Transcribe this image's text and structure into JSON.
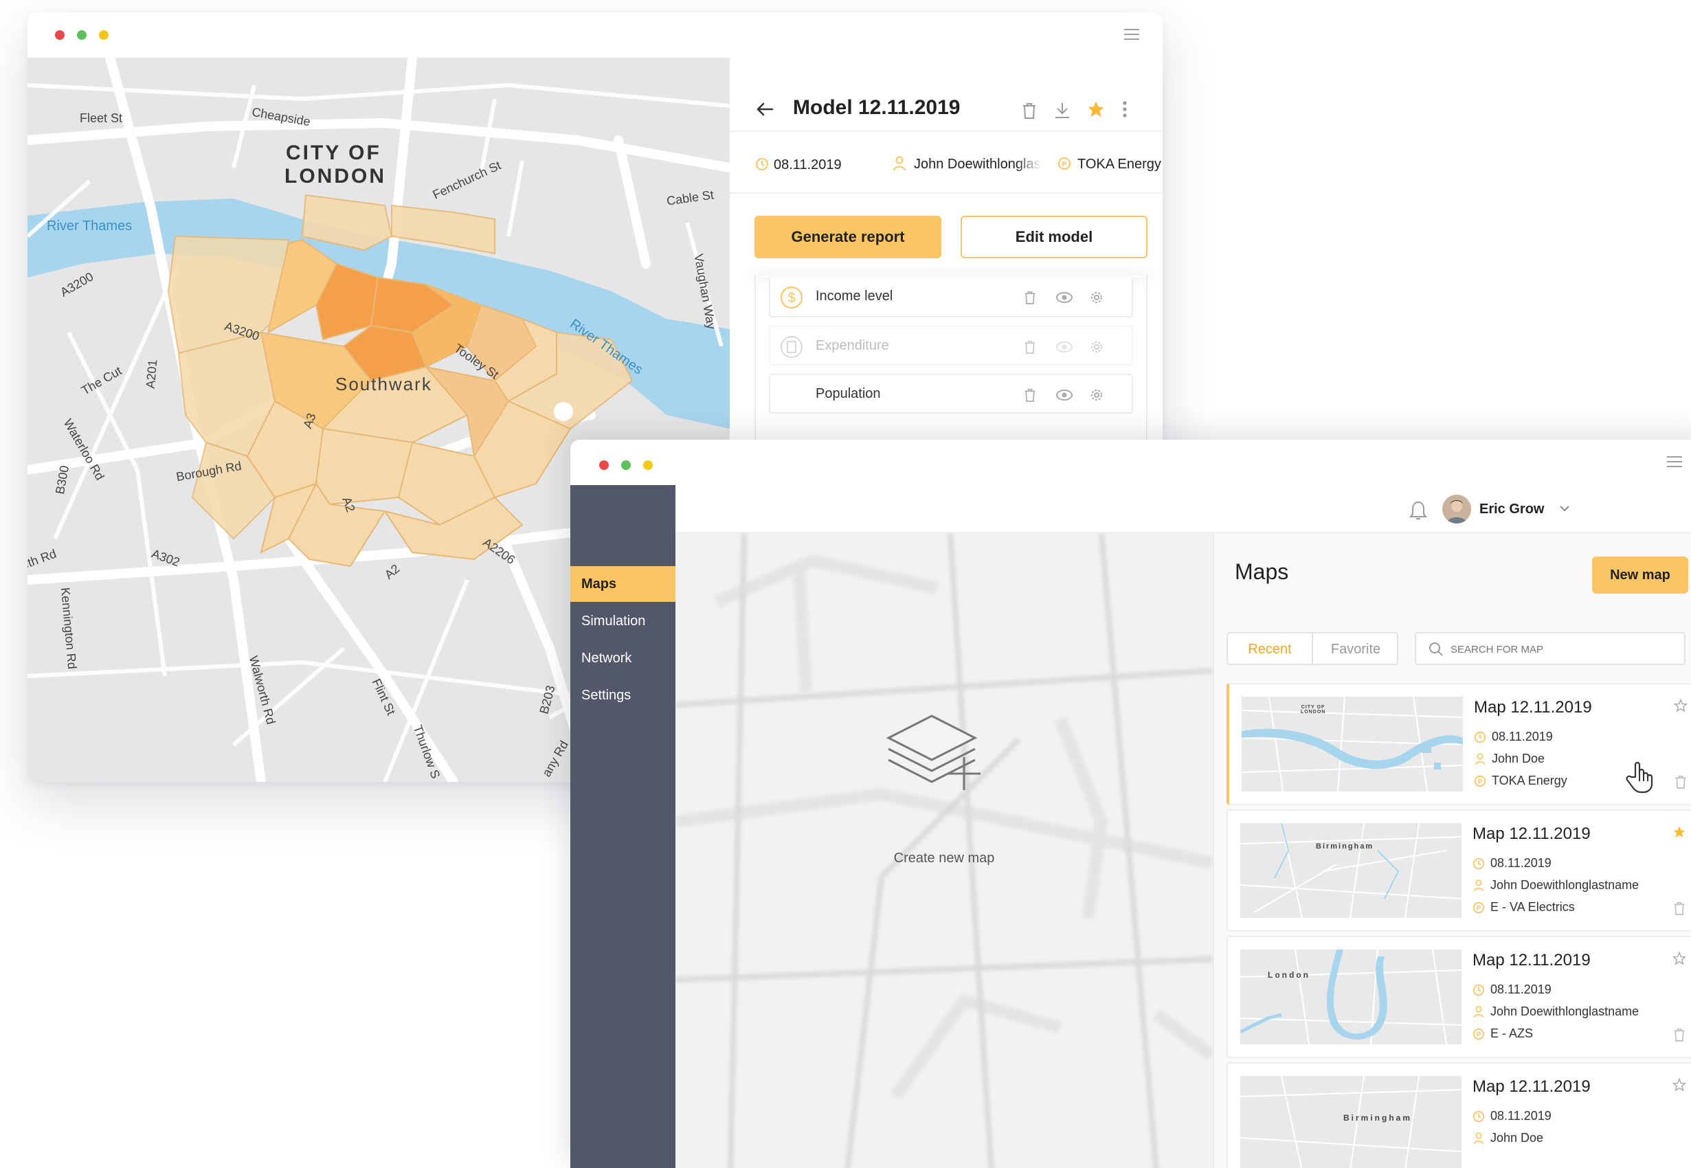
{
  "colors": {
    "accent": "#fcc563",
    "sidebar": "#525769",
    "river": "#a8d5ee",
    "zone_light": "#f5d9ab",
    "zone_dark": "#f4a04a"
  },
  "window1": {
    "map_labels": {
      "fleet_st": "Fleet St",
      "cheapside": "Cheapside",
      "city_of_london_1": "CITY OF",
      "city_of_london_2": "LONDON",
      "fenchurch": "Fenchurch St",
      "cable_st": "Cable St",
      "river_thames_left": "River Thames",
      "river_thames_right": "River Thames",
      "a3200_left": "A3200",
      "a3200_mid": "A3200",
      "the_cut": "The Cut",
      "a201": "A201",
      "waterloo": "Waterloo Rd",
      "b300": "B300",
      "southwark": "Southwark",
      "tooley": "Tooley St",
      "vaughan": "Vaughan Way",
      "borough": "Borough Rd",
      "a3": "A3",
      "a2": "A2",
      "a2_lower": "A2",
      "a2206": "A2206",
      "a302": "A302",
      "kennington": "Kennington Rd",
      "eth_rd": "eth Rd",
      "walworth": "Walworth Rd",
      "flint": "Flint St",
      "thurlow": "Thurlow S",
      "b203": "B203",
      "any_rd": "any Rd"
    },
    "panel": {
      "back_icon": "arrow-left-icon",
      "title": "Model 12.11.2019",
      "actions": [
        "trash-icon",
        "download-icon",
        "star-icon",
        "more-vertical-icon"
      ],
      "date": "08.11.2019",
      "user": "John Doewithlonglast",
      "company": "TOKA Energy",
      "generate_label": "Generate report",
      "edit_label": "Edit model",
      "layers": [
        {
          "label": "Income level",
          "icon": "dollar-icon"
        },
        {
          "label": "Expenditure",
          "icon": "receipt-icon"
        },
        {
          "label": "Population",
          "icon": ""
        }
      ]
    }
  },
  "window2": {
    "nav": {
      "maps": "Maps",
      "simulation": "Simulation",
      "network": "Network",
      "settings": "Settings"
    },
    "user_name": "Eric Grow",
    "create_label": "Create new map",
    "panel_title": "Maps",
    "new_map_label": "New map",
    "tabs": {
      "recent": "Recent",
      "favorite": "Favorite"
    },
    "search_placeholder": "SEARCH FOR MAP",
    "cards": [
      {
        "title": "Map 12.11.2019",
        "date": "08.11.2019",
        "user": "John Doe",
        "company": "TOKA Energy",
        "starred": false,
        "thumb_label": "CITY OF LONDON"
      },
      {
        "title": "Map 12.11.2019",
        "date": "08.11.2019",
        "user": "John Doewithlonglastname",
        "company": "E - VA Electrics",
        "starred": true,
        "thumb_label": "Birmingham"
      },
      {
        "title": "Map 12.11.2019",
        "date": "08.11.2019",
        "user": "John Doewithlonglastname",
        "company": "E - AZS",
        "starred": false,
        "thumb_label": "London"
      },
      {
        "title": "Map 12.11.2019",
        "date": "08.11.2019",
        "user": "John Doe",
        "company": "",
        "starred": false,
        "thumb_label": "Birmingham"
      }
    ]
  }
}
